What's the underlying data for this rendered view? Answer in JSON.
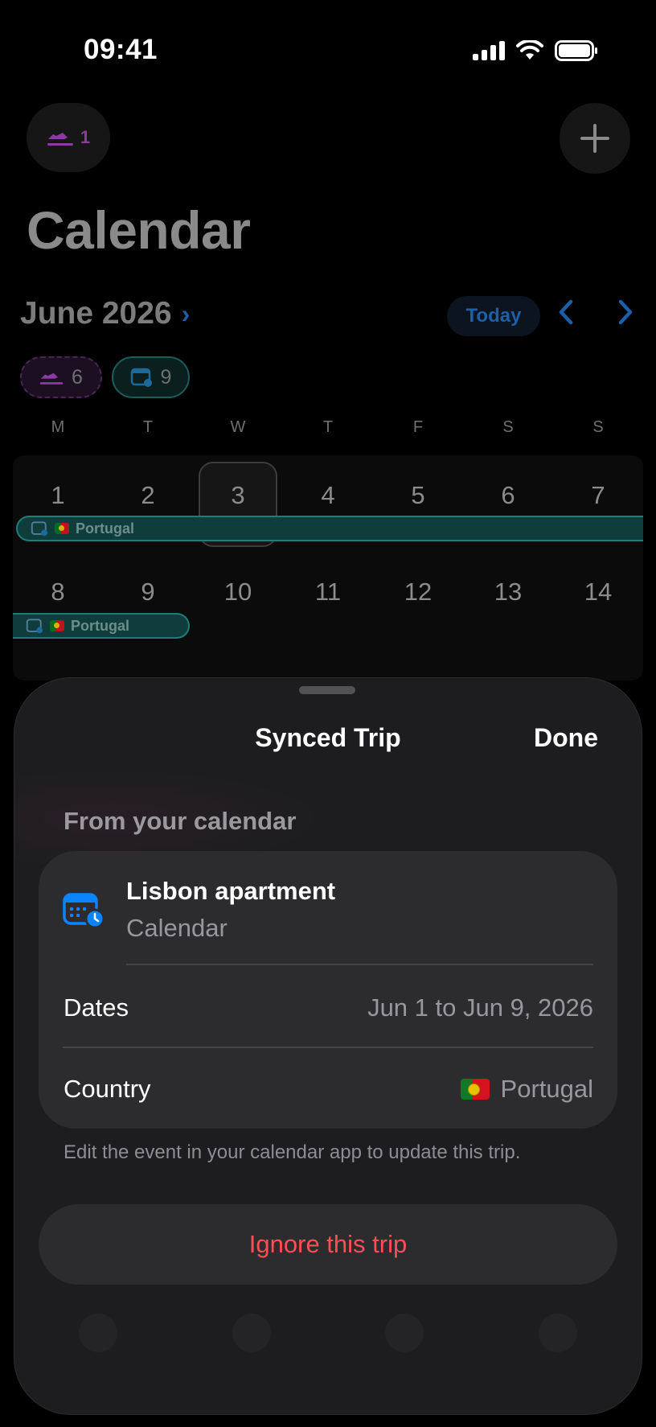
{
  "status_bar": {
    "time": "09:41"
  },
  "header": {
    "trip_count": "1",
    "page_title": "Calendar"
  },
  "calendar": {
    "month": "June 2026",
    "today_label": "Today",
    "filters": {
      "trips_count": "6",
      "calendar_count": "9"
    },
    "weekdays": [
      "M",
      "T",
      "W",
      "T",
      "F",
      "S",
      "S"
    ],
    "week1": [
      "1",
      "2",
      "3",
      "4",
      "5",
      "6",
      "7"
    ],
    "week2": [
      "8",
      "9",
      "10",
      "11",
      "12",
      "13",
      "14"
    ],
    "trip_bar_label": "Portugal",
    "selected_day": "3"
  },
  "sheet": {
    "title": "Synced Trip",
    "done_label": "Done",
    "section_label": "From your calendar",
    "event_title": "Lisbon apartment",
    "event_source": "Calendar",
    "dates_label": "Dates",
    "dates_value": "Jun 1 to Jun 9, 2026",
    "country_label": "Country",
    "country_value": "Portugal",
    "footnote": "Edit the event in your calendar app to update this trip.",
    "ignore_label": "Ignore this trip"
  },
  "colors": {
    "accent_blue": "#0a84ff",
    "destructive_red": "#ff4f55",
    "trip_purple": "#bf5af2",
    "synced_teal": "#1f7c78"
  },
  "icons": [
    "signal-icon",
    "wifi-icon",
    "battery-icon",
    "plane-landing-icon",
    "plus-icon",
    "chevron-right-icon",
    "chevron-left-icon",
    "calendar-sync-icon",
    "portugal-flag-icon"
  ]
}
